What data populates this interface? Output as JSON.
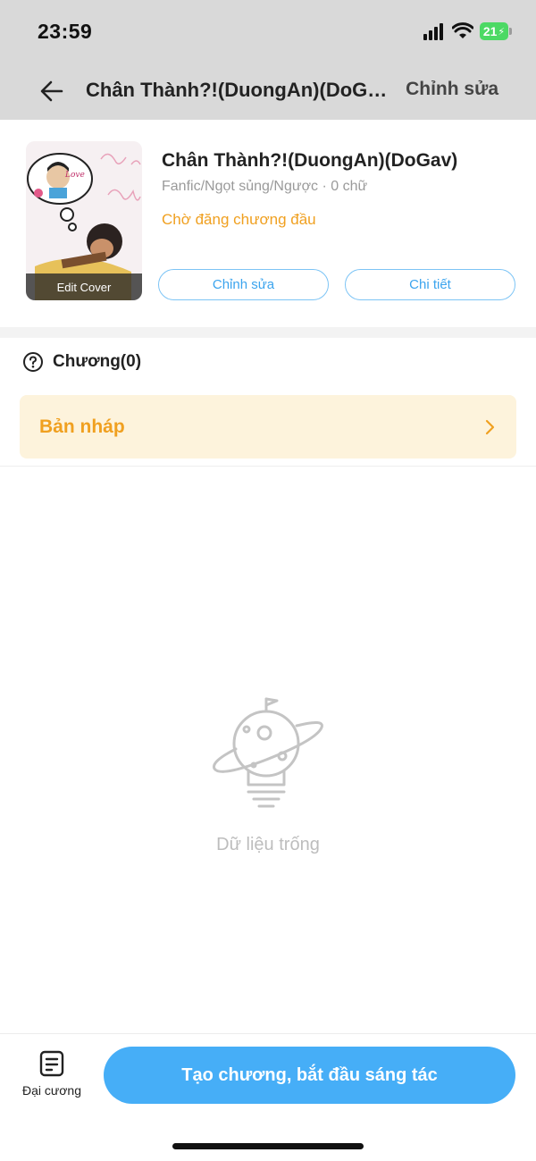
{
  "status_bar": {
    "time": "23:59",
    "battery": "21"
  },
  "nav": {
    "title": "Chân Thành?!(DuongAn)(DoGav)",
    "edit_label": "Chỉnh sửa"
  },
  "book": {
    "title": "Chân Thành?!(DuongAn)(DoGav)",
    "meta": "Fanfic/Ngọt sủng/Ngược · 0 chữ",
    "status": "Chờ đăng chương đầu",
    "cover_label": "Edit Cover",
    "edit_button": "Chỉnh sửa",
    "detail_button": "Chi tiết"
  },
  "chapters": {
    "title": "Chương(0)",
    "draft_label": "Bản nháp"
  },
  "empty_state": {
    "text": "Dữ liệu trống"
  },
  "bottom_bar": {
    "outline_label": "Đại cương",
    "primary_button": "Tạo chương, bắt đầu sáng tác"
  },
  "colors": {
    "accent": "#46aef7",
    "warning": "#f0a020",
    "draft_bg": "#fdf3dc"
  },
  "icons": [
    "back-arrow-icon",
    "help-circle-icon",
    "chevron-right-icon",
    "planet-bulb-icon",
    "outline-document-icon"
  ]
}
